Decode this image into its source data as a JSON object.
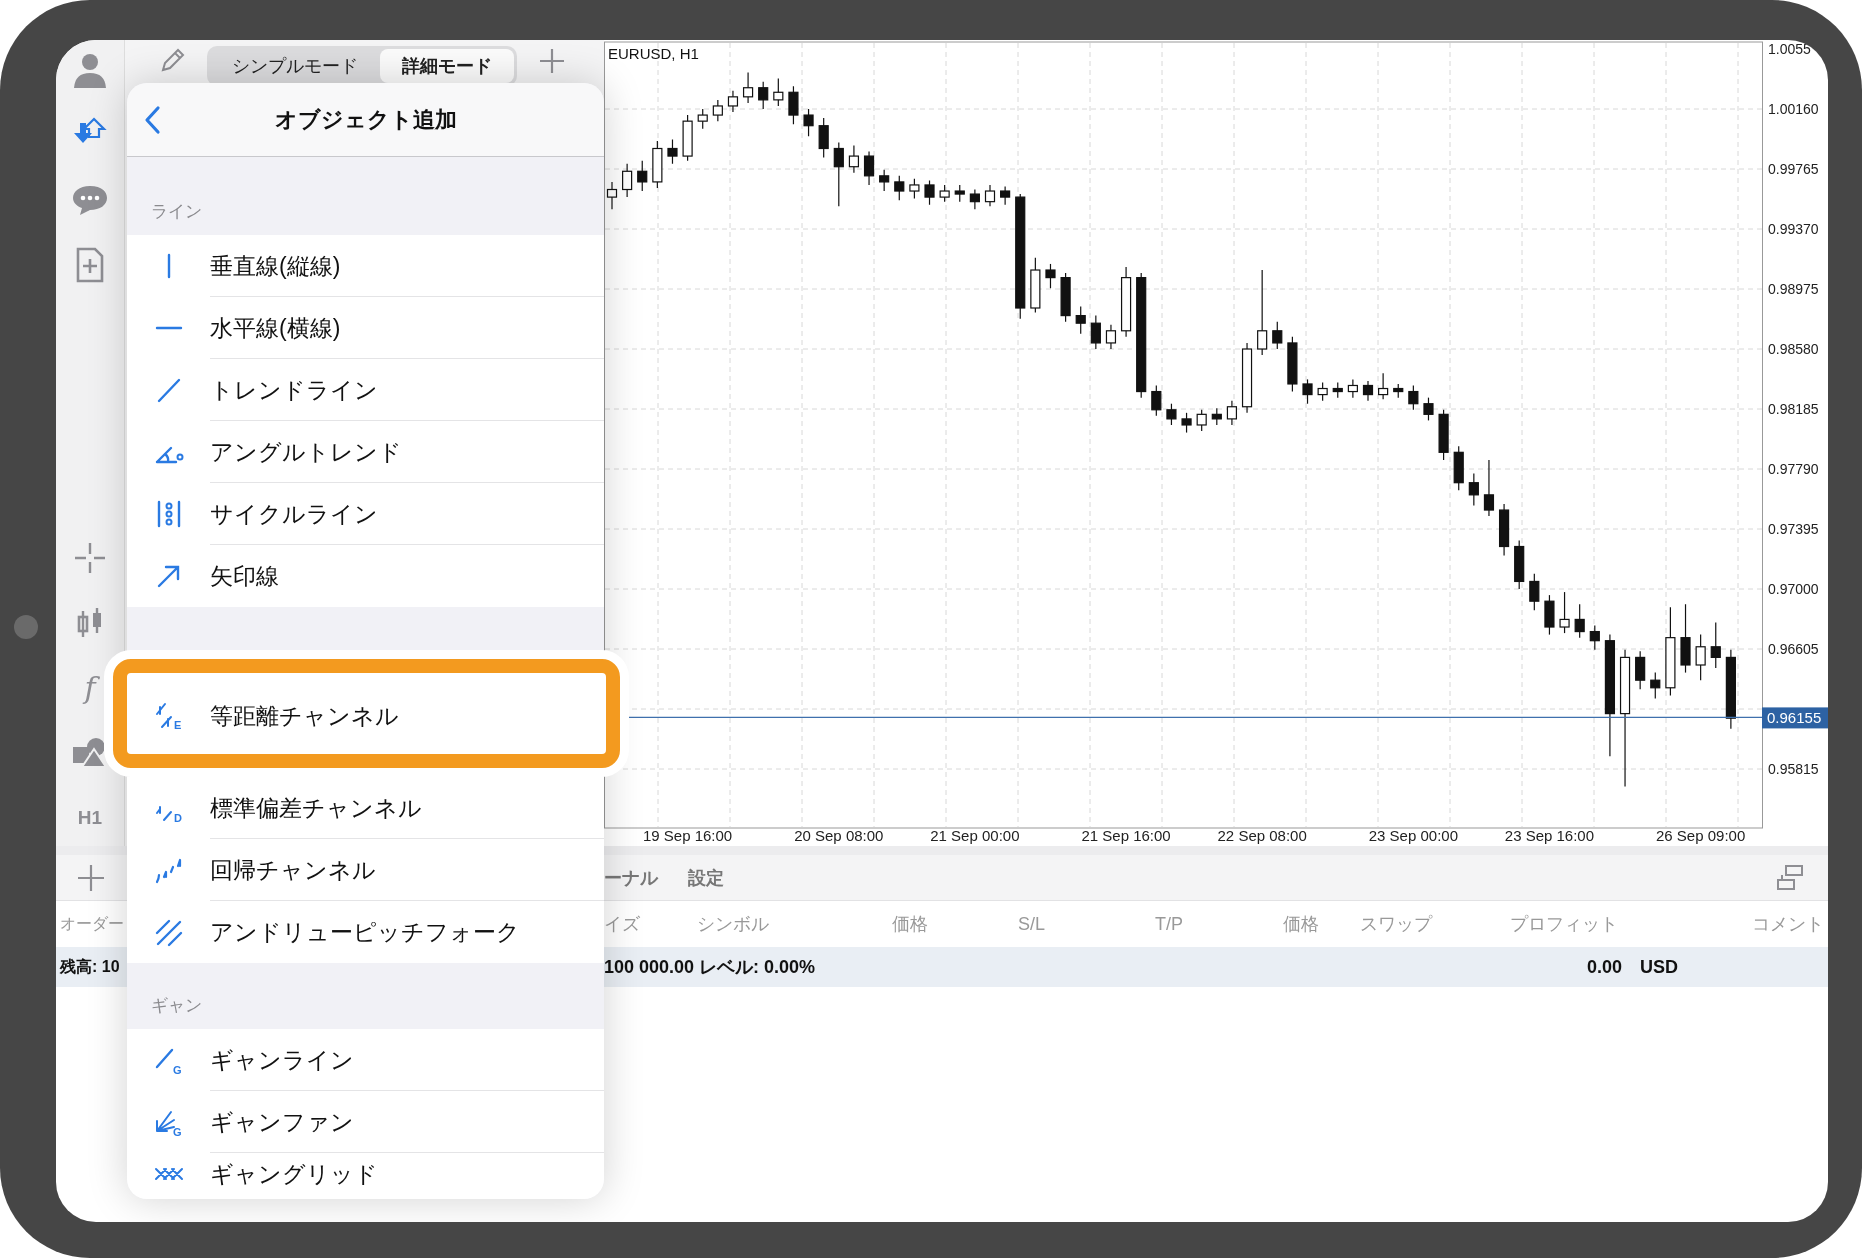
{
  "sidebar": {
    "function_label": "f",
    "timeframe": "H1"
  },
  "mode_tabs": [
    {
      "label": "シンプルモード",
      "selected": false
    },
    {
      "label": "詳細モード",
      "selected": true
    }
  ],
  "menu": {
    "title": "オブジェクト追加",
    "sections": [
      {
        "header": "ライン",
        "items": [
          {
            "label": "垂直線(縦線)",
            "highlighted": false
          },
          {
            "label": "水平線(横線)",
            "highlighted": false
          },
          {
            "label": "トレンドライン",
            "highlighted": false
          },
          {
            "label": "アングルトレンド",
            "highlighted": false
          },
          {
            "label": "サイクルライン",
            "highlighted": false
          },
          {
            "label": "矢印線",
            "highlighted": false
          }
        ]
      },
      {
        "items": [
          {
            "label": "等距離チャンネル",
            "highlighted": true,
            "icon_letter": "E"
          },
          {
            "label": "標準偏差チャンネル",
            "highlighted": false,
            "icon_letter": "D"
          },
          {
            "label": "回帰チャンネル",
            "highlighted": false
          },
          {
            "label": "アンドリューピッチフォーク",
            "highlighted": false
          }
        ]
      },
      {
        "header": "ギャン",
        "items": [
          {
            "label": "ギャンライン",
            "highlighted": false,
            "icon_letter": "G"
          },
          {
            "label": "ギャンファン",
            "highlighted": false,
            "icon_letter": "G"
          },
          {
            "label": "ギャングリッド",
            "highlighted": false
          }
        ]
      }
    ]
  },
  "chart": {
    "title": "EURUSD, H1",
    "chart_data": {
      "type": "candlestick",
      "grid": true,
      "ref_lines": [
        {
          "axis": "y",
          "value": 0.96155,
          "label": "0.96155",
          "color": "#3f70ad"
        }
      ],
      "yticks": [
        {
          "value": 1.00555,
          "label": "1.0055"
        },
        {
          "value": 1.0016,
          "label": "1.00160"
        },
        {
          "value": 0.99765,
          "label": "0.99765"
        },
        {
          "value": 0.9937,
          "label": "0.99370"
        },
        {
          "value": 0.98975,
          "label": "0.98975"
        },
        {
          "value": 0.9858,
          "label": "0.98580"
        },
        {
          "value": 0.98185,
          "label": "0.98185"
        },
        {
          "value": 0.9779,
          "label": "0.97790"
        },
        {
          "value": 0.97395,
          "label": "0.97395"
        },
        {
          "value": 0.97,
          "label": "0.97000"
        },
        {
          "value": 0.96605,
          "label": "0.96605"
        },
        {
          "value": 0.95815,
          "label": "0.95815"
        }
      ],
      "ylim": [
        0.95427,
        1.00601
      ],
      "categories": [
        null,
        null,
        null,
        null,
        null,
        "19 Sep 16:00",
        null,
        null,
        null,
        null,
        null,
        null,
        null,
        null,
        null,
        "20 Sep 08:00",
        null,
        null,
        null,
        null,
        null,
        null,
        null,
        null,
        "21 Sep 00:00",
        null,
        null,
        null,
        null,
        null,
        null,
        null,
        null,
        null,
        "21 Sep 16:00",
        null,
        null,
        null,
        null,
        null,
        null,
        null,
        null,
        "22 Sep 08:00",
        null,
        null,
        null,
        null,
        null,
        null,
        null,
        null,
        null,
        "23 Sep 00:00",
        null,
        null,
        null,
        null,
        null,
        null,
        null,
        null,
        "23 Sep 16:00",
        null,
        null,
        null,
        null,
        null,
        null,
        null,
        null,
        null,
        "26 Sep 09:00",
        null,
        null
      ],
      "ohlc": [
        [
          0.9958,
          0.9968,
          0.995,
          0.9963
        ],
        [
          0.9963,
          0.998,
          0.9958,
          0.9975
        ],
        [
          0.9975,
          0.9982,
          0.9962,
          0.9968
        ],
        [
          0.9968,
          0.9995,
          0.9964,
          0.999
        ],
        [
          0.999,
          0.9996,
          0.998,
          0.9985
        ],
        [
          0.9985,
          1.0012,
          0.9982,
          1.0008
        ],
        [
          1.0008,
          1.0016,
          1.0003,
          1.0012
        ],
        [
          1.0012,
          1.0022,
          1.0008,
          1.0018
        ],
        [
          1.0018,
          1.0028,
          1.0014,
          1.0024
        ],
        [
          1.0024,
          1.004,
          1.002,
          1.003
        ],
        [
          1.003,
          1.0034,
          1.0016,
          1.0022
        ],
        [
          1.0022,
          1.0036,
          1.0018,
          1.0027
        ],
        [
          1.0027,
          1.0031,
          1.0006,
          1.0012
        ],
        [
          1.0012,
          1.0016,
          0.9998,
          1.0005
        ],
        [
          1.0005,
          1.001,
          0.9984,
          0.999
        ],
        [
          0.999,
          0.9994,
          0.9952,
          0.9978
        ],
        [
          0.9978,
          0.9992,
          0.9974,
          0.9985
        ],
        [
          0.9985,
          0.9988,
          0.9966,
          0.9972
        ],
        [
          0.9972,
          0.9976,
          0.9962,
          0.9968
        ],
        [
          0.9968,
          0.9972,
          0.9956,
          0.9962
        ],
        [
          0.9962,
          0.997,
          0.9957,
          0.9966
        ],
        [
          0.9966,
          0.9969,
          0.9953,
          0.9958
        ],
        [
          0.9958,
          0.9966,
          0.9955,
          0.9962
        ],
        [
          0.9962,
          0.9966,
          0.9955,
          0.996
        ],
        [
          0.996,
          0.9963,
          0.995,
          0.9955
        ],
        [
          0.9955,
          0.9966,
          0.9952,
          0.9962
        ],
        [
          0.9962,
          0.9965,
          0.9953,
          0.9958
        ],
        [
          0.9958,
          0.996,
          0.9878,
          0.9885
        ],
        [
          0.9885,
          0.9918,
          0.9882,
          0.991
        ],
        [
          0.991,
          0.9914,
          0.9898,
          0.9905
        ],
        [
          0.9905,
          0.9908,
          0.9876,
          0.988
        ],
        [
          0.988,
          0.9886,
          0.9868,
          0.9875
        ],
        [
          0.9875,
          0.988,
          0.9858,
          0.9862
        ],
        [
          0.9862,
          0.9874,
          0.9858,
          0.987
        ],
        [
          0.987,
          0.9912,
          0.9866,
          0.9905
        ],
        [
          0.9905,
          0.9908,
          0.9826,
          0.983
        ],
        [
          0.983,
          0.9834,
          0.9814,
          0.9818
        ],
        [
          0.9818,
          0.9822,
          0.9808,
          0.9812
        ],
        [
          0.9812,
          0.9816,
          0.9803,
          0.9808
        ],
        [
          0.9808,
          0.9818,
          0.9804,
          0.9815
        ],
        [
          0.9815,
          0.9819,
          0.9808,
          0.9812
        ],
        [
          0.9812,
          0.9824,
          0.9808,
          0.982
        ],
        [
          0.982,
          0.9862,
          0.9816,
          0.9858
        ],
        [
          0.9858,
          0.991,
          0.9854,
          0.987
        ],
        [
          0.987,
          0.9876,
          0.9858,
          0.9862
        ],
        [
          0.9862,
          0.9866,
          0.983,
          0.9835
        ],
        [
          0.9835,
          0.9838,
          0.9822,
          0.9828
        ],
        [
          0.9828,
          0.9836,
          0.9824,
          0.9832
        ],
        [
          0.9832,
          0.9836,
          0.9826,
          0.983
        ],
        [
          0.983,
          0.9838,
          0.9826,
          0.9834
        ],
        [
          0.9834,
          0.9837,
          0.9824,
          0.9828
        ],
        [
          0.9828,
          0.9842,
          0.9825,
          0.9832
        ],
        [
          0.9832,
          0.9835,
          0.9826,
          0.983
        ],
        [
          0.983,
          0.9834,
          0.9818,
          0.9822
        ],
        [
          0.9822,
          0.9826,
          0.9811,
          0.9815
        ],
        [
          0.9815,
          0.9818,
          0.9785,
          0.979
        ],
        [
          0.979,
          0.9794,
          0.9765,
          0.977
        ],
        [
          0.977,
          0.9776,
          0.9755,
          0.9762
        ],
        [
          0.9762,
          0.9785,
          0.9748,
          0.9752
        ],
        [
          0.9752,
          0.9756,
          0.9722,
          0.9728
        ],
        [
          0.9728,
          0.9732,
          0.97,
          0.9705
        ],
        [
          0.9705,
          0.971,
          0.9686,
          0.9692
        ],
        [
          0.9692,
          0.9696,
          0.967,
          0.9675
        ],
        [
          0.9675,
          0.9698,
          0.9671,
          0.968
        ],
        [
          0.968,
          0.969,
          0.9668,
          0.9672
        ],
        [
          0.9672,
          0.9676,
          0.966,
          0.9666
        ],
        [
          0.9666,
          0.967,
          0.959,
          0.9618
        ],
        [
          0.9618,
          0.966,
          0.957,
          0.9655
        ],
        [
          0.9655,
          0.9659,
          0.9634,
          0.964
        ],
        [
          0.964,
          0.9645,
          0.9628,
          0.9635
        ],
        [
          0.9635,
          0.9688,
          0.963,
          0.9668
        ],
        [
          0.9668,
          0.969,
          0.9645,
          0.965
        ],
        [
          0.965,
          0.967,
          0.964,
          0.9662
        ],
        [
          0.9662,
          0.9678,
          0.9648,
          0.9655
        ],
        [
          0.9655,
          0.966,
          0.9608,
          0.9615
        ]
      ]
    }
  },
  "terminal": {
    "tabs": [
      "ーナル",
      "設定"
    ],
    "left_header": "オーダー",
    "columns": [
      "イズ",
      "シンボル",
      "価格",
      "S/L",
      "T/P",
      "価格",
      "スワップ",
      "プロフィット",
      "コメント"
    ],
    "balance_left": "残高: 10",
    "balance": "100 000.00 レベル: 0.00%",
    "profit": "0.00",
    "currency": "USD"
  }
}
